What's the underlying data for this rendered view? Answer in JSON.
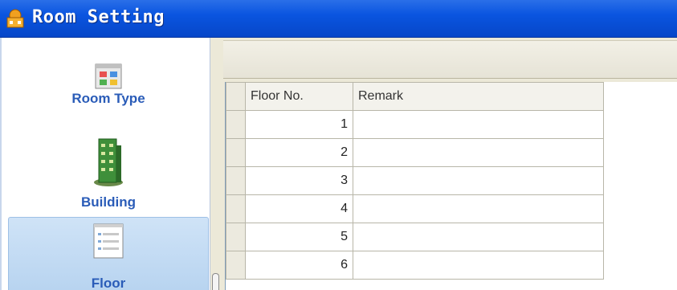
{
  "window": {
    "title": "Room Setting",
    "icon": "app-house-icon"
  },
  "sidebar": {
    "items": [
      {
        "label": "Room Type",
        "icon": "room-type-icon",
        "selected": false
      },
      {
        "label": "Building",
        "icon": "building-icon",
        "selected": false
      },
      {
        "label": "Floor",
        "icon": "floor-icon",
        "selected": true
      }
    ]
  },
  "grid": {
    "columns": [
      "Floor No.",
      "Remark"
    ],
    "rows": [
      {
        "floor_no": "1",
        "remark": ""
      },
      {
        "floor_no": "2",
        "remark": ""
      },
      {
        "floor_no": "3",
        "remark": ""
      },
      {
        "floor_no": "4",
        "remark": ""
      },
      {
        "floor_no": "5",
        "remark": ""
      },
      {
        "floor_no": "6",
        "remark": ""
      }
    ]
  },
  "colors": {
    "titlebar": "#0a55e0",
    "nav_text": "#2a5cb8",
    "selected_bg": "#b8d4f0"
  }
}
